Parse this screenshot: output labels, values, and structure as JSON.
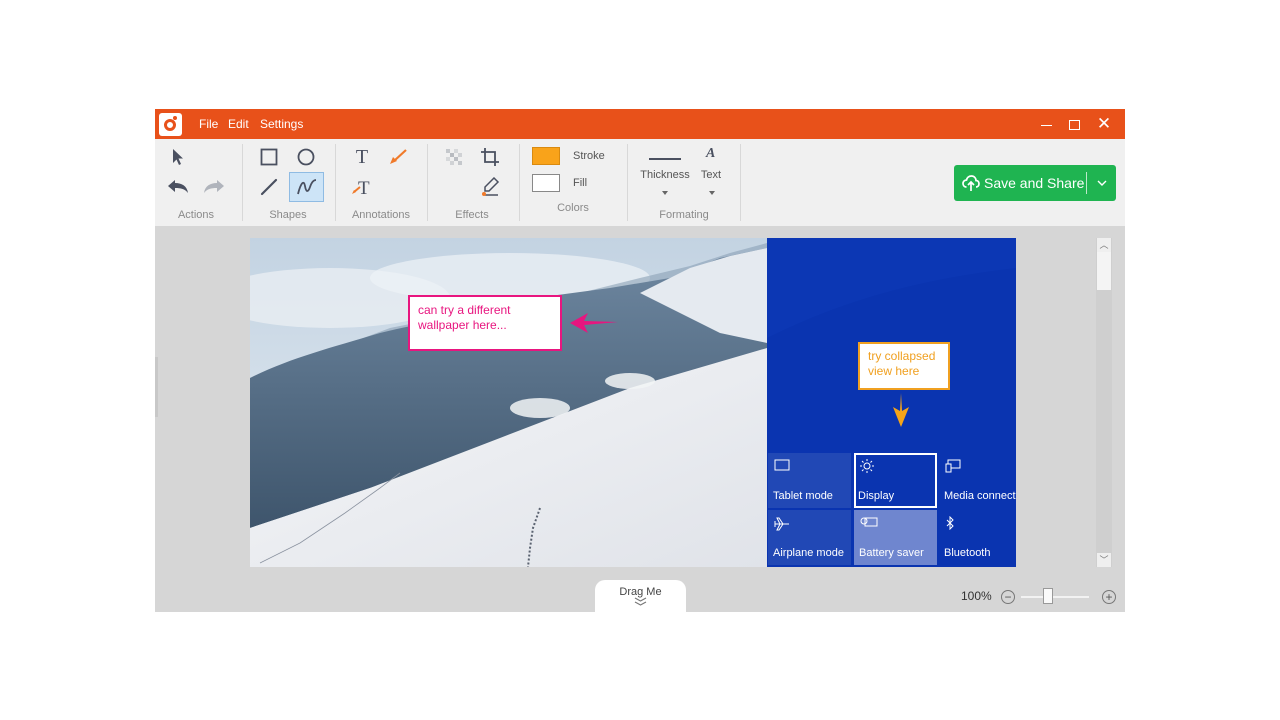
{
  "app": {
    "menu": [
      "File",
      "Edit",
      "Settings"
    ],
    "window_controls": [
      "minimize",
      "maximize",
      "close"
    ],
    "accent_color": "#e8511a"
  },
  "ribbon": {
    "groups": [
      {
        "label": "Actions",
        "tools": [
          "select-pointer",
          "undo",
          "redo"
        ]
      },
      {
        "label": "Shapes",
        "tools": [
          "rectangle",
          "ellipse",
          "line",
          "freehand-curve"
        ],
        "active_tool": "freehand-curve"
      },
      {
        "label": "Annotations",
        "tools": [
          "text",
          "arrow",
          "text-with-arrow"
        ]
      },
      {
        "label": "Effects",
        "tools": [
          "pixelate",
          "crop",
          "highlighter"
        ]
      },
      {
        "label": "Colors",
        "tools": [
          "stroke",
          "fill"
        ]
      },
      {
        "label": "Formating",
        "tools": [
          "thickness",
          "text-format"
        ]
      }
    ],
    "colors": {
      "stroke_label": "Stroke",
      "fill_label": "Fill",
      "stroke_color": "#f9a31a",
      "fill_color": "#ffffff"
    },
    "formatting": {
      "thickness_label": "Thickness",
      "text_label": "Text"
    },
    "save_button": {
      "label": "Save and Share",
      "color": "#1fb451"
    }
  },
  "canvas": {
    "annotations": [
      {
        "text": "can try a different wallpaper here...",
        "line1": "can try a different",
        "line2": "wallpaper here...",
        "color": "#e8157f"
      },
      {
        "text": "try collapsed view here",
        "line1": "try collapsed",
        "line2": "view here",
        "color": "#f0a020"
      }
    ],
    "quick_actions": [
      {
        "label": "Tablet mode",
        "icon": "tablet-icon",
        "state": "off"
      },
      {
        "label": "Display",
        "icon": "brightness-icon",
        "state": "selected"
      },
      {
        "label": "Media connect",
        "icon": "cast-icon",
        "state": "off"
      },
      {
        "label": "Airplane mode",
        "icon": "airplane-icon",
        "state": "off"
      },
      {
        "label": "Battery saver",
        "icon": "battery-saver-icon",
        "state": "on"
      },
      {
        "label": "Bluetooth",
        "icon": "bluetooth-icon",
        "state": "off"
      }
    ]
  },
  "footer": {
    "drag_label": "Drag Me",
    "zoom_level": "100%",
    "zoom_slider_fraction": 0.4
  }
}
